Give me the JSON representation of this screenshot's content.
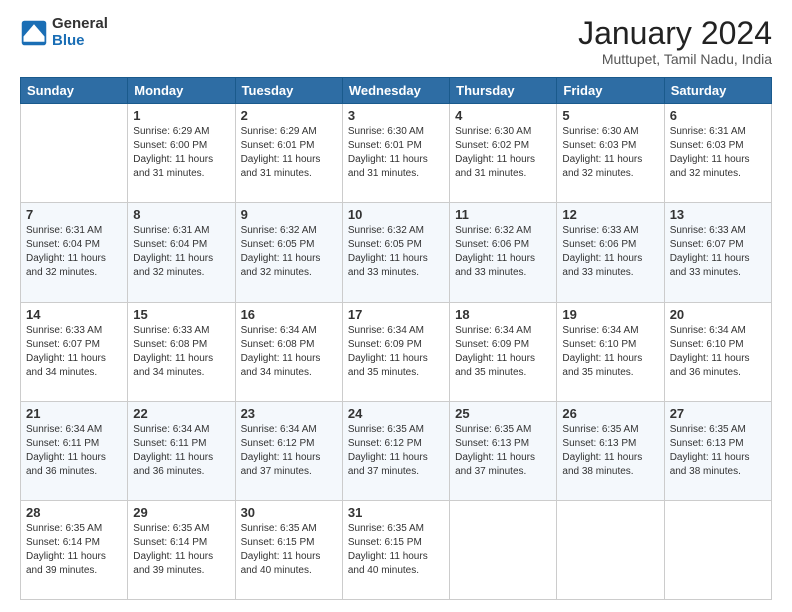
{
  "logo": {
    "general": "General",
    "blue": "Blue"
  },
  "header": {
    "month": "January 2024",
    "location": "Muttupet, Tamil Nadu, India"
  },
  "weekdays": [
    "Sunday",
    "Monday",
    "Tuesday",
    "Wednesday",
    "Thursday",
    "Friday",
    "Saturday"
  ],
  "weeks": [
    [
      {
        "day": "",
        "info": ""
      },
      {
        "day": "1",
        "info": "Sunrise: 6:29 AM\nSunset: 6:00 PM\nDaylight: 11 hours\nand 31 minutes."
      },
      {
        "day": "2",
        "info": "Sunrise: 6:29 AM\nSunset: 6:01 PM\nDaylight: 11 hours\nand 31 minutes."
      },
      {
        "day": "3",
        "info": "Sunrise: 6:30 AM\nSunset: 6:01 PM\nDaylight: 11 hours\nand 31 minutes."
      },
      {
        "day": "4",
        "info": "Sunrise: 6:30 AM\nSunset: 6:02 PM\nDaylight: 11 hours\nand 31 minutes."
      },
      {
        "day": "5",
        "info": "Sunrise: 6:30 AM\nSunset: 6:03 PM\nDaylight: 11 hours\nand 32 minutes."
      },
      {
        "day": "6",
        "info": "Sunrise: 6:31 AM\nSunset: 6:03 PM\nDaylight: 11 hours\nand 32 minutes."
      }
    ],
    [
      {
        "day": "7",
        "info": "Sunrise: 6:31 AM\nSunset: 6:04 PM\nDaylight: 11 hours\nand 32 minutes."
      },
      {
        "day": "8",
        "info": "Sunrise: 6:31 AM\nSunset: 6:04 PM\nDaylight: 11 hours\nand 32 minutes."
      },
      {
        "day": "9",
        "info": "Sunrise: 6:32 AM\nSunset: 6:05 PM\nDaylight: 11 hours\nand 32 minutes."
      },
      {
        "day": "10",
        "info": "Sunrise: 6:32 AM\nSunset: 6:05 PM\nDaylight: 11 hours\nand 33 minutes."
      },
      {
        "day": "11",
        "info": "Sunrise: 6:32 AM\nSunset: 6:06 PM\nDaylight: 11 hours\nand 33 minutes."
      },
      {
        "day": "12",
        "info": "Sunrise: 6:33 AM\nSunset: 6:06 PM\nDaylight: 11 hours\nand 33 minutes."
      },
      {
        "day": "13",
        "info": "Sunrise: 6:33 AM\nSunset: 6:07 PM\nDaylight: 11 hours\nand 33 minutes."
      }
    ],
    [
      {
        "day": "14",
        "info": "Sunrise: 6:33 AM\nSunset: 6:07 PM\nDaylight: 11 hours\nand 34 minutes."
      },
      {
        "day": "15",
        "info": "Sunrise: 6:33 AM\nSunset: 6:08 PM\nDaylight: 11 hours\nand 34 minutes."
      },
      {
        "day": "16",
        "info": "Sunrise: 6:34 AM\nSunset: 6:08 PM\nDaylight: 11 hours\nand 34 minutes."
      },
      {
        "day": "17",
        "info": "Sunrise: 6:34 AM\nSunset: 6:09 PM\nDaylight: 11 hours\nand 35 minutes."
      },
      {
        "day": "18",
        "info": "Sunrise: 6:34 AM\nSunset: 6:09 PM\nDaylight: 11 hours\nand 35 minutes."
      },
      {
        "day": "19",
        "info": "Sunrise: 6:34 AM\nSunset: 6:10 PM\nDaylight: 11 hours\nand 35 minutes."
      },
      {
        "day": "20",
        "info": "Sunrise: 6:34 AM\nSunset: 6:10 PM\nDaylight: 11 hours\nand 36 minutes."
      }
    ],
    [
      {
        "day": "21",
        "info": "Sunrise: 6:34 AM\nSunset: 6:11 PM\nDaylight: 11 hours\nand 36 minutes."
      },
      {
        "day": "22",
        "info": "Sunrise: 6:34 AM\nSunset: 6:11 PM\nDaylight: 11 hours\nand 36 minutes."
      },
      {
        "day": "23",
        "info": "Sunrise: 6:34 AM\nSunset: 6:12 PM\nDaylight: 11 hours\nand 37 minutes."
      },
      {
        "day": "24",
        "info": "Sunrise: 6:35 AM\nSunset: 6:12 PM\nDaylight: 11 hours\nand 37 minutes."
      },
      {
        "day": "25",
        "info": "Sunrise: 6:35 AM\nSunset: 6:13 PM\nDaylight: 11 hours\nand 37 minutes."
      },
      {
        "day": "26",
        "info": "Sunrise: 6:35 AM\nSunset: 6:13 PM\nDaylight: 11 hours\nand 38 minutes."
      },
      {
        "day": "27",
        "info": "Sunrise: 6:35 AM\nSunset: 6:13 PM\nDaylight: 11 hours\nand 38 minutes."
      }
    ],
    [
      {
        "day": "28",
        "info": "Sunrise: 6:35 AM\nSunset: 6:14 PM\nDaylight: 11 hours\nand 39 minutes."
      },
      {
        "day": "29",
        "info": "Sunrise: 6:35 AM\nSunset: 6:14 PM\nDaylight: 11 hours\nand 39 minutes."
      },
      {
        "day": "30",
        "info": "Sunrise: 6:35 AM\nSunset: 6:15 PM\nDaylight: 11 hours\nand 40 minutes."
      },
      {
        "day": "31",
        "info": "Sunrise: 6:35 AM\nSunset: 6:15 PM\nDaylight: 11 hours\nand 40 minutes."
      },
      {
        "day": "",
        "info": ""
      },
      {
        "day": "",
        "info": ""
      },
      {
        "day": "",
        "info": ""
      }
    ]
  ]
}
